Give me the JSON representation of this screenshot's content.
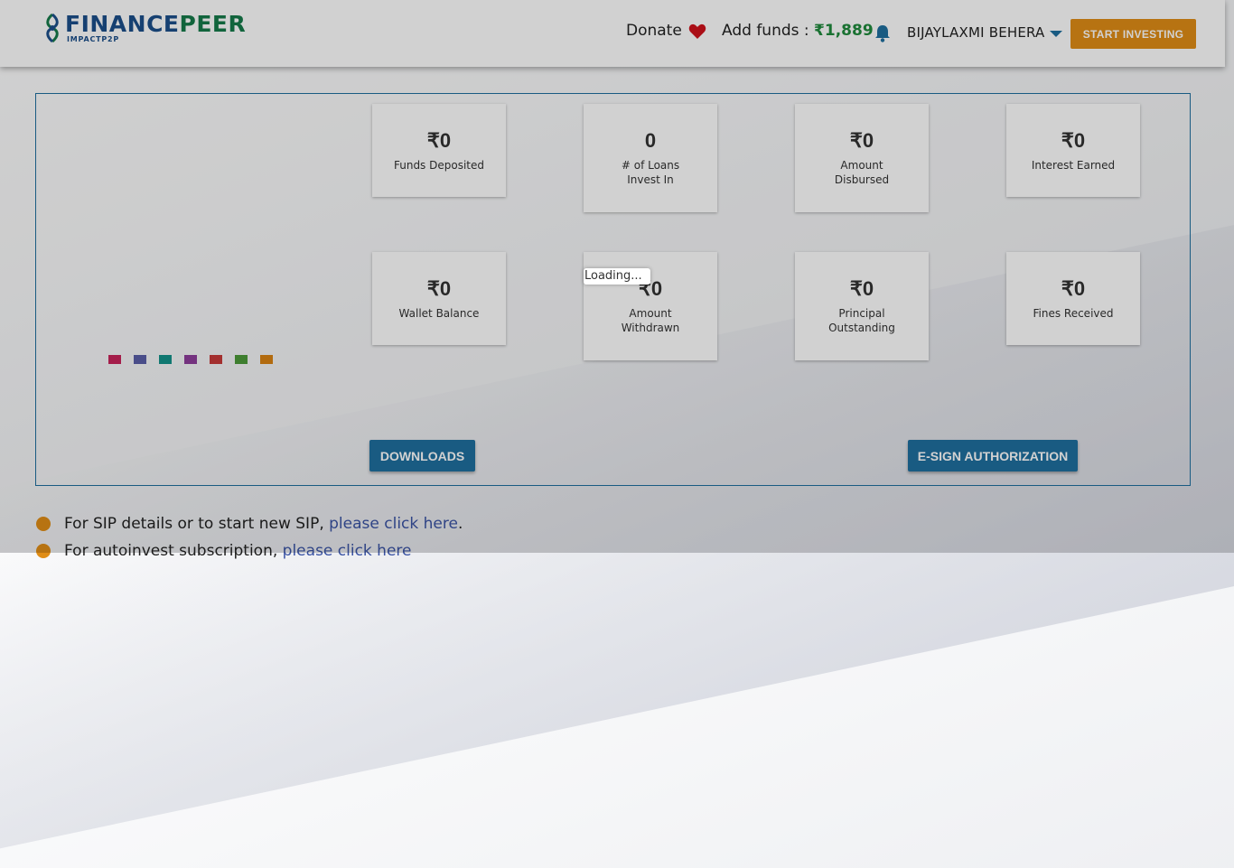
{
  "header": {
    "logo_primary": "FINANCE",
    "logo_secondary": "PEER",
    "logo_sub": "IMPACTP2P",
    "donate_label": "Donate",
    "add_funds_label": "Add funds :",
    "add_funds_amount": "₹1,889",
    "user_name": "BIJAYLAXMI BEHERA",
    "start_investing_label": "START INVESTING"
  },
  "stats": [
    {
      "value": "₹0",
      "label": "Funds Deposited"
    },
    {
      "value": "0",
      "label": "# of Loans Invest In"
    },
    {
      "value": "₹0",
      "label": "Amount Disbursed"
    },
    {
      "value": "₹0",
      "label": "Interest Earned"
    },
    {
      "value": "₹0",
      "label": "Wallet Balance"
    },
    {
      "value": "₹0",
      "label": "Amount Withdrawn"
    },
    {
      "value": "₹0",
      "label": "Principal Outstanding"
    },
    {
      "value": "₹0",
      "label": "Fines Received"
    }
  ],
  "loading_text": "Loading...",
  "dot_colors": [
    "#c9245b",
    "#5a5ea8",
    "#14938a",
    "#8e3d9c",
    "#c73a3a",
    "#4c9a3a",
    "#d98313"
  ],
  "buttons": {
    "downloads": "DOWNLOADS",
    "esign": "E-SIGN AUTHORIZATION"
  },
  "info": {
    "sip_text": "For SIP details or to start new SIP,",
    "sip_link": "please click here",
    "sip_after": ".",
    "autoinvest_text": "For autoinvest subscription,",
    "autoinvest_link": "please click here"
  },
  "colors": {
    "accent_blue": "#1f6f9f",
    "accent_orange": "#e08d16",
    "amount_green": "#1f8a3c",
    "heart_red": "#d0121b"
  }
}
